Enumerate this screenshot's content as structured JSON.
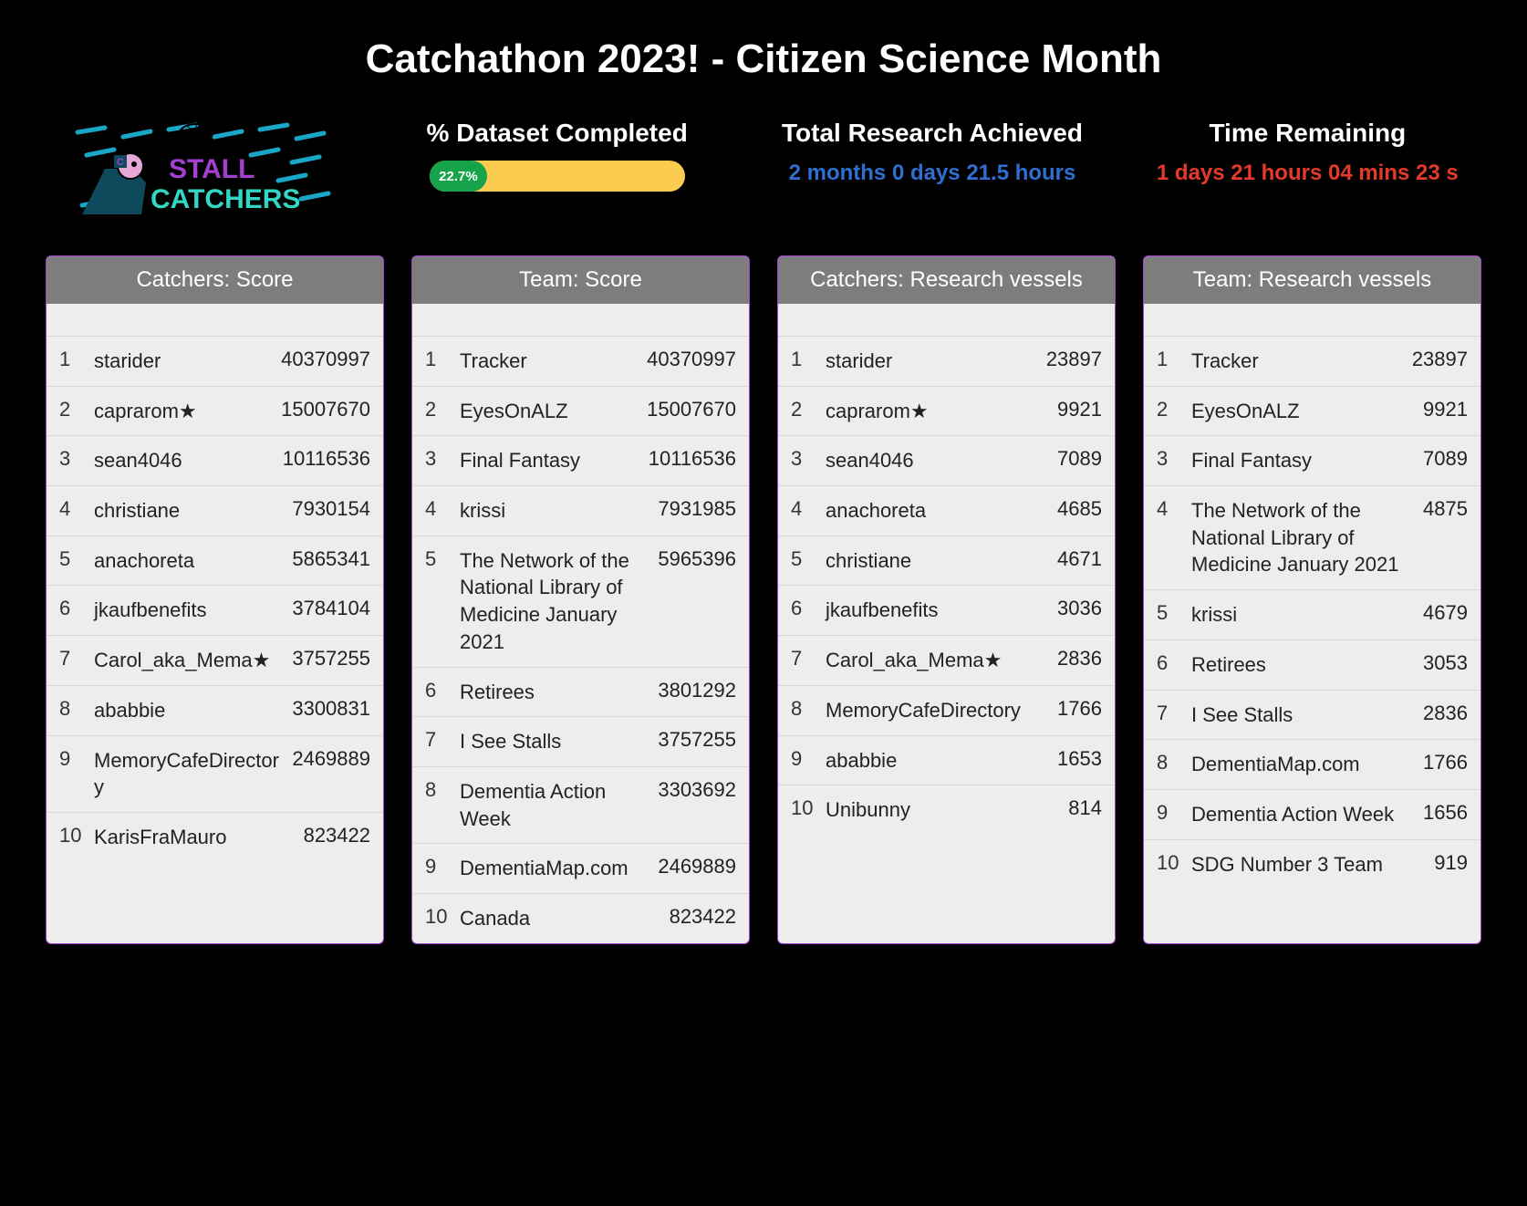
{
  "page_title": "Catchathon 2023! - Citizen Science Month",
  "logo_text_top": "STALL",
  "logo_text_bottom": "CATCHERS",
  "stats": {
    "dataset": {
      "label": "% Dataset Completed",
      "percent_text": "22.7%",
      "percent_value": 22.7
    },
    "research": {
      "label": "Total Research Achieved",
      "value": "2 months 0 days 21.5 hours"
    },
    "time": {
      "label": "Time Remaining",
      "value": "1 days 21 hours 04 mins 23 s"
    }
  },
  "boards": [
    {
      "title": "Catchers: Score",
      "rows": [
        {
          "rank": "1",
          "name": "starider",
          "score": "40370997"
        },
        {
          "rank": "2",
          "name": "caprarom★",
          "score": "15007670"
        },
        {
          "rank": "3",
          "name": "sean4046",
          "score": "10116536"
        },
        {
          "rank": "4",
          "name": "christiane",
          "score": "7930154"
        },
        {
          "rank": "5",
          "name": "anachoreta",
          "score": "5865341"
        },
        {
          "rank": "6",
          "name": "jkaufbenefits",
          "score": "3784104"
        },
        {
          "rank": "7",
          "name": "Carol_aka_Mema★",
          "score": "3757255"
        },
        {
          "rank": "8",
          "name": "ababbie",
          "score": "3300831"
        },
        {
          "rank": "9",
          "name": "MemoryCafeDirectory",
          "score": "2469889"
        },
        {
          "rank": "10",
          "name": "KarisFraMauro",
          "score": "823422"
        }
      ]
    },
    {
      "title": "Team: Score",
      "rows": [
        {
          "rank": "1",
          "name": "Tracker",
          "score": "40370997"
        },
        {
          "rank": "2",
          "name": "EyesOnALZ",
          "score": "15007670"
        },
        {
          "rank": "3",
          "name": "Final Fantasy",
          "score": "10116536"
        },
        {
          "rank": "4",
          "name": "krissi",
          "score": "7931985"
        },
        {
          "rank": "5",
          "name": "The Network of the National Library of Medicine January 2021",
          "score": "5965396"
        },
        {
          "rank": "6",
          "name": "Retirees",
          "score": "3801292"
        },
        {
          "rank": "7",
          "name": "I See Stalls",
          "score": "3757255"
        },
        {
          "rank": "8",
          "name": "Dementia Action Week",
          "score": "3303692"
        },
        {
          "rank": "9",
          "name": "DementiaMap.com",
          "score": "2469889"
        },
        {
          "rank": "10",
          "name": "Canada",
          "score": "823422"
        }
      ]
    },
    {
      "title": "Catchers: Research vessels",
      "rows": [
        {
          "rank": "1",
          "name": "starider",
          "score": "23897"
        },
        {
          "rank": "2",
          "name": "caprarom★",
          "score": "9921"
        },
        {
          "rank": "3",
          "name": "sean4046",
          "score": "7089"
        },
        {
          "rank": "4",
          "name": "anachoreta",
          "score": "4685"
        },
        {
          "rank": "5",
          "name": "christiane",
          "score": "4671"
        },
        {
          "rank": "6",
          "name": "jkaufbenefits",
          "score": "3036"
        },
        {
          "rank": "7",
          "name": "Carol_aka_Mema★",
          "score": "2836"
        },
        {
          "rank": "8",
          "name": "MemoryCafeDirectory",
          "score": "1766"
        },
        {
          "rank": "9",
          "name": "ababbie",
          "score": "1653"
        },
        {
          "rank": "10",
          "name": "Unibunny",
          "score": "814"
        }
      ]
    },
    {
      "title": "Team: Research vessels",
      "rows": [
        {
          "rank": "1",
          "name": "Tracker",
          "score": "23897"
        },
        {
          "rank": "2",
          "name": "EyesOnALZ",
          "score": "9921"
        },
        {
          "rank": "3",
          "name": "Final Fantasy",
          "score": "7089"
        },
        {
          "rank": "4",
          "name": "The Network of the National Library of Medicine January 2021",
          "score": "4875"
        },
        {
          "rank": "5",
          "name": "krissi",
          "score": "4679"
        },
        {
          "rank": "6",
          "name": "Retirees",
          "score": "3053"
        },
        {
          "rank": "7",
          "name": "I See Stalls",
          "score": "2836"
        },
        {
          "rank": "8",
          "name": "DementiaMap.com",
          "score": "1766"
        },
        {
          "rank": "9",
          "name": "Dementia Action Week",
          "score": "1656"
        },
        {
          "rank": "10",
          "name": "SDG Number 3 Team",
          "score": "919"
        }
      ]
    }
  ]
}
